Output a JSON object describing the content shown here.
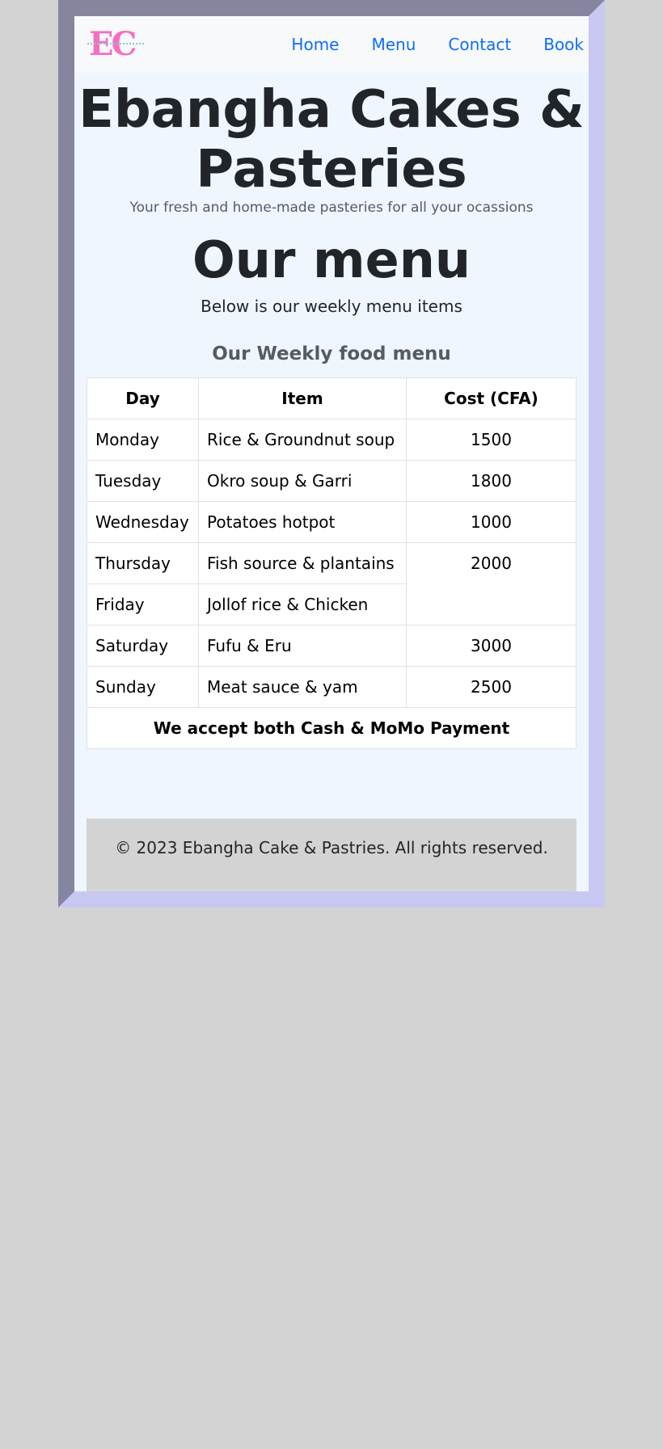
{
  "nav": {
    "logo_text": "EC",
    "links": [
      "Home",
      "Menu",
      "Contact",
      "Book"
    ]
  },
  "hero": {
    "title": "Ebangha Cakes & Pasteries",
    "tagline": "Your fresh and home-made pasteries for all your ocassions"
  },
  "menu": {
    "heading": "Our menu",
    "subtitle": "Below is our weekly menu items",
    "table_title": "Our Weekly food menu",
    "columns": [
      "Day",
      "Item",
      "Cost (CFA)"
    ],
    "rows": [
      {
        "day": "Monday",
        "item": "Rice & Groundnut soup",
        "cost": "1500"
      },
      {
        "day": "Tuesday",
        "item": "Okro soup & Garri",
        "cost": "1800"
      },
      {
        "day": "Wednesday",
        "item": "Potatoes hotpot",
        "cost": "1000"
      },
      {
        "day": "Thursday",
        "item": "Fish source & plantains",
        "cost": "2000"
      },
      {
        "day": "Friday",
        "item": "Jollof rice & Chicken",
        "cost": ""
      },
      {
        "day": "Saturday",
        "item": "Fufu & Eru",
        "cost": "3000"
      },
      {
        "day": "Sunday",
        "item": "Meat sauce & yam",
        "cost": "2500"
      }
    ],
    "payment_note": "We accept both Cash & MoMo Payment"
  },
  "footer": {
    "copyright": "© 2023 Ebangha Cake & Pastries. All rights reserved."
  },
  "colors": {
    "page_background": "#d3d3d3",
    "content_background": "#eff6fe",
    "link": "#0d6efd",
    "logo": "#f56fc0",
    "frame_dark": "#85859f",
    "frame_light": "#c8c8f2"
  }
}
